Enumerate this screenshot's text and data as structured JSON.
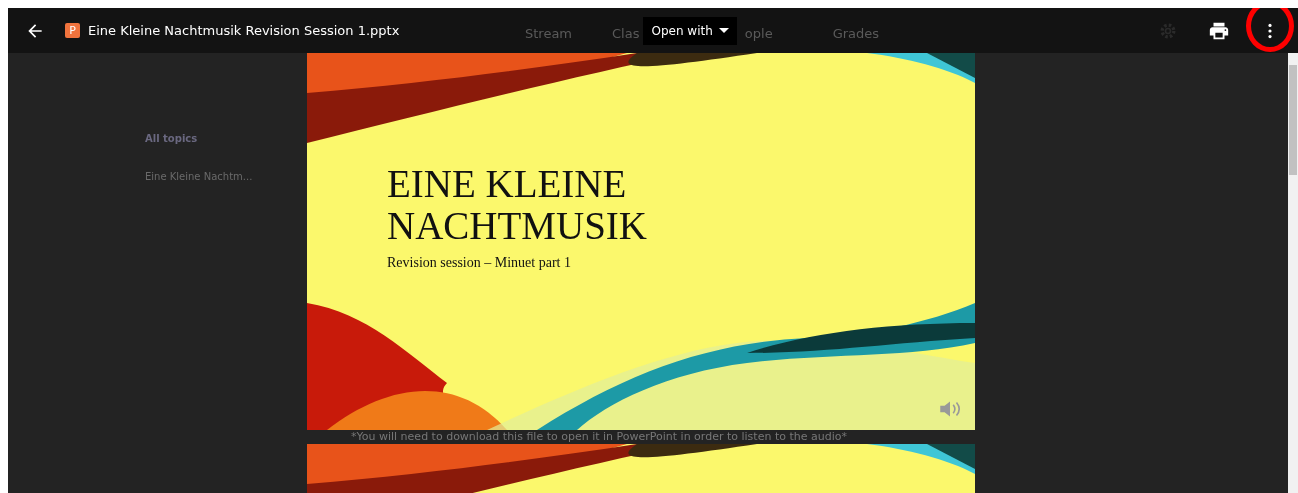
{
  "top_bar": {
    "file_title": "Eine Kleine Nachtmusik Revision Session 1.pptx",
    "file_type_letter": "P",
    "open_with_button": "Open with"
  },
  "background_tabs": [
    "Stream",
    "Clas",
    "ople",
    "Grades"
  ],
  "background_sidebar": {
    "heading": "All topics",
    "items": [
      "Eine Kleine Nachtm..."
    ]
  },
  "slides": [
    {
      "title_lines": [
        "EINE KLEINE",
        "NACHTMUSIK"
      ],
      "subtitle": "Revision session – Minuet part 1",
      "has_audio": true
    },
    {
      "has_audio": false
    }
  ],
  "slide_note": "*You will need to download this file to open it in PowerPoint in order to listen to the audio*",
  "annotation": {
    "highlighted": true
  }
}
